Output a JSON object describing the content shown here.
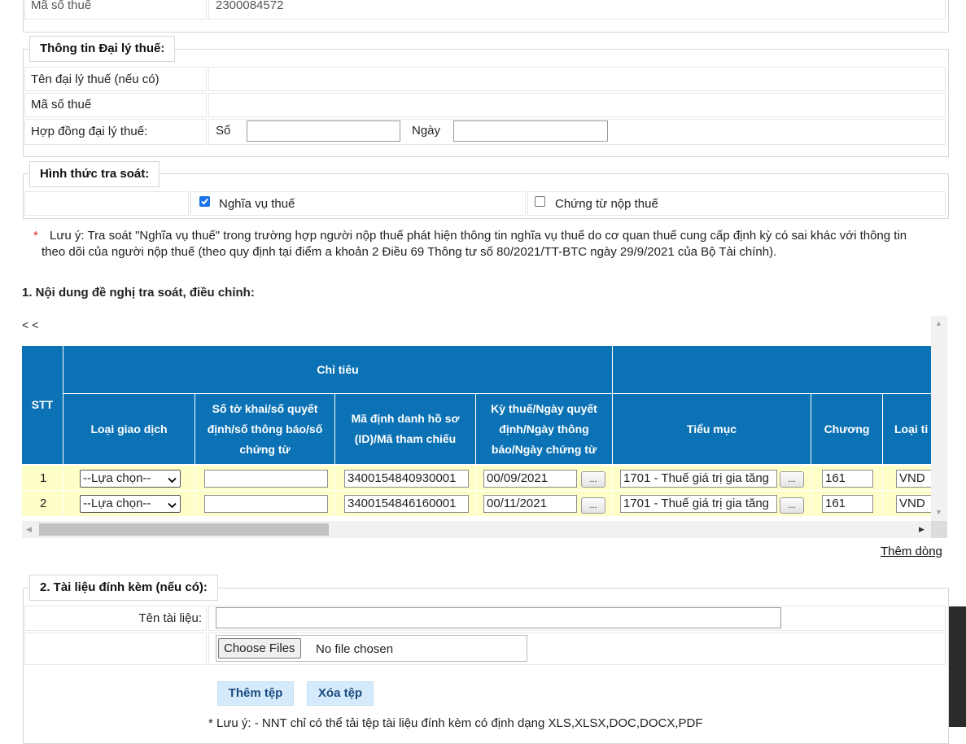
{
  "taxpayer": {
    "tax_code_label": "Mã số thuế",
    "tax_code_value": "2300084572"
  },
  "agent": {
    "legend": "Thông tin Đại lý thuế:",
    "name_label": "Tên đại lý thuế (nếu có)",
    "tax_code_label": "Mã số thuế",
    "contract_label": "Hợp đồng đại lý thuế:",
    "number_label": "Số",
    "date_label": "Ngày",
    "number_value": "",
    "date_value": ""
  },
  "review_type": {
    "legend": "Hình thức tra soát:",
    "options": [
      {
        "label": "Nghĩa vụ thuế",
        "checked": true
      },
      {
        "label": "Chứng từ nộp thuế",
        "checked": false
      }
    ]
  },
  "note": {
    "star": "*",
    "text": "Lưu ý: Tra soát \"Nghĩa vụ thuế\" trong trường hợp người nộp thuế phát hiện thông tin nghĩa vụ thuế do cơ quan thuế cung cấp định kỳ có sai khác với thông tin theo dõi của người nộp thuế (theo quy định tại điểm a khoản 2 Điều 69 Thông tư số 80/2021/TT-BTC ngày 29/9/2021 của Bộ Tài chính)."
  },
  "section1": {
    "title": "1. Nội dung đề nghị tra soát, điều chỉnh:",
    "nav": "< <",
    "headers": {
      "stt": "STT",
      "group": "Chỉ tiêu",
      "cols": [
        "Loại giao dịch",
        "Số tờ khai/số quyết định/số thông báo/số chứng từ",
        "Mã định danh hồ sơ (ID)/Mã tham chiếu",
        "Kỳ thuế/Ngày quyết định/Ngày thông báo/Ngày chứng từ",
        "Tiểu mục",
        "Chương",
        "Loại ti"
      ]
    },
    "rows": [
      {
        "stt": "1",
        "type": "--Lựa chọn--",
        "doc_no": "",
        "id": "3400154840930001",
        "period": "00/09/2021",
        "dots": "...",
        "item": "1701 - Thuế giá trị gia tăng",
        "chapter": "161",
        "currency": "VND"
      },
      {
        "stt": "2",
        "type": "--Lựa chọn--",
        "doc_no": "",
        "id": "3400154846160001",
        "period": "00/11/2021",
        "dots": "...",
        "item": "1701 - Thuế giá trị gia tăng",
        "chapter": "161",
        "currency": "VND"
      }
    ],
    "scroll_up": "▲",
    "scroll_down": "▼",
    "scroll_left": "◀",
    "scroll_right": "▶",
    "add_row": "Thêm dòng"
  },
  "section2": {
    "legend": "2. Tài liệu đính kèm (nếu có):",
    "doc_name_label": "Tên tài liệu:",
    "doc_name_value": "",
    "choose_files": "Choose Files",
    "no_file": "No file chosen",
    "add_file": "Thêm tệp",
    "delete_file": "Xóa tệp",
    "note": "* Lưu ý: - NNT chỉ có thể tải tệp tài liệu đính kèm có định dạng XLS,XLSX,DOC,DOCX,PDF"
  },
  "colors": {
    "header_blue": "#0b72b5",
    "row_yellow": "#fefec8",
    "button_blue": "#d5ebfb",
    "note_star": "#e02020"
  }
}
